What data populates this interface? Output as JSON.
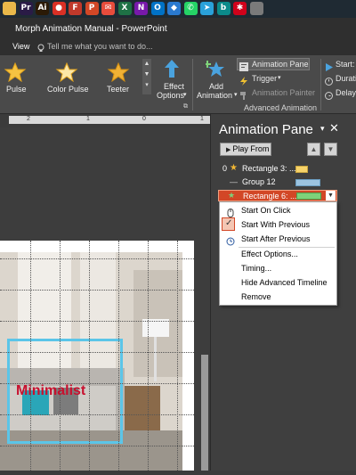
{
  "taskbar": {
    "icons": [
      {
        "name": "folder-icon",
        "glyph": "",
        "color": "#e8b84a"
      },
      {
        "name": "premiere-icon",
        "glyph": "Pr",
        "color": "#2a1b46"
      },
      {
        "name": "illustrator-icon",
        "glyph": "Ai",
        "color": "#2b1a06"
      },
      {
        "name": "chrome-icon",
        "glyph": "●",
        "color": "#d93025"
      },
      {
        "name": "filezilla-icon",
        "glyph": "F",
        "color": "#c0392b"
      },
      {
        "name": "powerpoint-icon",
        "glyph": "P",
        "color": "#d24726"
      },
      {
        "name": "mail-icon",
        "glyph": "✉",
        "color": "#e74c3c"
      },
      {
        "name": "excel-icon",
        "glyph": "X",
        "color": "#1e7145"
      },
      {
        "name": "onenote-icon",
        "glyph": "N",
        "color": "#7719aa"
      },
      {
        "name": "outlook-icon",
        "glyph": "O",
        "color": "#0072c6"
      },
      {
        "name": "dropbox-icon",
        "glyph": "◆",
        "color": "#2a7ad0"
      },
      {
        "name": "whatsapp-icon",
        "glyph": "✆",
        "color": "#25d366"
      },
      {
        "name": "telegram-icon",
        "glyph": "➤",
        "color": "#2aa1da"
      },
      {
        "name": "bing-icon",
        "glyph": "b",
        "color": "#0b8a8a"
      },
      {
        "name": "app-asterisk-icon",
        "glyph": "✱",
        "color": "#d0021b"
      },
      {
        "name": "app-grey-icon",
        "glyph": "",
        "color": "#7a7a7a"
      }
    ]
  },
  "window": {
    "title": "Morph Animation Manual  -  PowerPoint"
  },
  "menu": {
    "view": "View",
    "tell_me": "Tell me what you want to do..."
  },
  "ribbon": {
    "effects": [
      {
        "label": "Pulse",
        "icon": "pulse-star-icon"
      },
      {
        "label": "Color Pulse",
        "icon": "color-pulse-star-icon"
      },
      {
        "label": "Teeter",
        "icon": "teeter-star-icon"
      }
    ],
    "effect_options_line1": "Effect",
    "effect_options_line2": "Options",
    "add_animation_line1": "Add",
    "add_animation_line2": "Animation",
    "animation_pane": "Animation Pane",
    "trigger": "Trigger",
    "animation_painter": "Animation Painter",
    "group_label": "Advanced Animation",
    "start": "Start:",
    "duration": "Duratio",
    "delay": "Delay:"
  },
  "ruler": {
    "ticks": [
      "2",
      "1",
      "0",
      "1"
    ]
  },
  "slide": {
    "heading": "Minimalist"
  },
  "pane": {
    "title": "Animation Pane",
    "play_from": "Play From",
    "items": [
      {
        "index": "0",
        "label": "Rectangle 3: ...",
        "bar_color": "#f7d36a",
        "selected": false
      },
      {
        "index": "",
        "label": "Group 12",
        "bar_color": "#9cc3e0",
        "selected": false
      },
      {
        "index": "",
        "label": "Rectangle 6: ...",
        "bar_color": "#7ed27a",
        "selected": true
      }
    ],
    "menu": {
      "start_on_click": "Start On Click",
      "start_with_previous": "Start With Previous",
      "start_after_previous": "Start After Previous",
      "effect_options": "Effect Options...",
      "timing": "Timing...",
      "hide_advanced_timeline": "Hide Advanced Timeline",
      "remove": "Remove"
    }
  },
  "colors": {
    "accent_selected": "#d24726",
    "ribbon_bg": "#4a4a4a"
  }
}
